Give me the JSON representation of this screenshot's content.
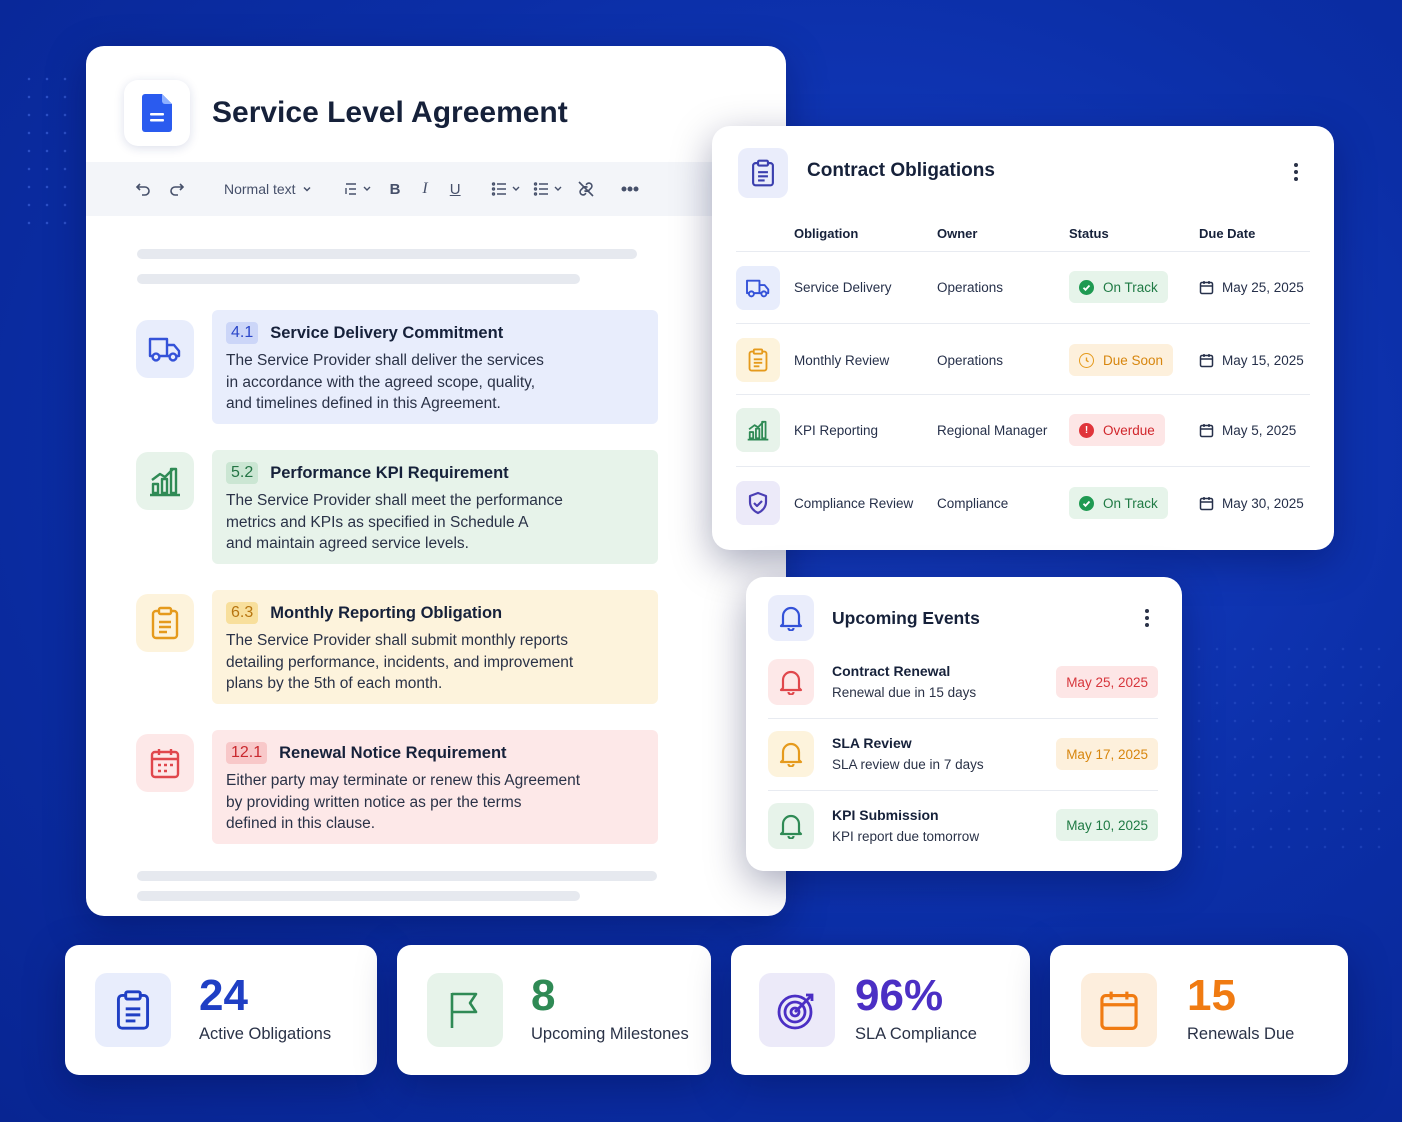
{
  "document": {
    "title": "Service Level Agreement",
    "toolbar": {
      "style_select": "Normal text"
    },
    "clauses": [
      {
        "number": "4.1",
        "title": "Service Delivery Commitment",
        "icon": "truck-icon",
        "lines": [
          "The Service Provider shall deliver the services",
          "in accordance with the agreed scope, quality,",
          "and timelines defined in this Agreement."
        ],
        "accent": "#3452d8",
        "bg": "#e8edfc"
      },
      {
        "number": "5.2",
        "title": "Performance KPI Requirement",
        "icon": "chart-icon",
        "lines": [
          "The Service Provider shall meet the performance",
          "metrics and KPIs as specified in Schedule A",
          "and maintain agreed service levels."
        ],
        "accent": "#2f8a55",
        "bg": "#e7f3ea"
      },
      {
        "number": "6.3",
        "title": "Monthly Reporting Obligation",
        "icon": "clipboard-icon",
        "lines": [
          "The Service Provider shall submit monthly reports",
          "detailing performance, incidents, and improvement",
          "plans by the 5th of each month."
        ],
        "accent": "#e59a1c",
        "bg": "#fdf3dc"
      },
      {
        "number": "12.1",
        "title": "Renewal Notice Requirement",
        "icon": "calendar-icon",
        "lines": [
          "Either party may terminate or renew this Agreement",
          "by providing written notice as per the terms",
          "defined in this clause."
        ],
        "accent": "#e0474c",
        "bg": "#fde8e8"
      }
    ]
  },
  "obligations": {
    "title": "Contract Obligations",
    "columns": [
      "Obligation",
      "Owner",
      "Status",
      "Due Date"
    ],
    "rows": [
      {
        "obligation": "Service Delivery",
        "owner": "Operations",
        "status": "On Track",
        "due": "May 25, 2025",
        "icon": "truck-icon"
      },
      {
        "obligation": "Monthly Review",
        "owner": "Operations",
        "status": "Due Soon",
        "due": "May 15, 2025",
        "icon": "clipboard-icon"
      },
      {
        "obligation": "KPI Reporting",
        "owner": "Regional Manager",
        "status": "Overdue",
        "due": "May 5, 2025",
        "icon": "chart-icon"
      },
      {
        "obligation": "Compliance Review",
        "owner": "Compliance",
        "status": "On Track",
        "due": "May 30, 2025",
        "icon": "shield-icon"
      }
    ]
  },
  "events": {
    "title": "Upcoming Events",
    "items": [
      {
        "title": "Contract Renewal",
        "subtitle": "Renewal due in 15 days",
        "date": "May 25, 2025",
        "icon": "bell-icon"
      },
      {
        "title": "SLA Review",
        "subtitle": "SLA review due in 7 days",
        "date": "May 17, 2025",
        "icon": "bell-icon"
      },
      {
        "title": "KPI Submission",
        "subtitle": "KPI report due tomorrow",
        "date": "May 10, 2025",
        "icon": "bell-icon"
      }
    ]
  },
  "stats": [
    {
      "value": "24",
      "label": "Active Obligations",
      "icon": "clipboard-icon",
      "color": "#1f3fc4"
    },
    {
      "value": "8",
      "label": "Upcoming Milestones",
      "icon": "flag-icon",
      "color": "#2f8a55"
    },
    {
      "value": "96%",
      "label": "SLA Compliance",
      "icon": "target-icon",
      "color": "#4b2fc4"
    },
    {
      "value": "15",
      "label": "Renewals Due",
      "icon": "calendar-icon",
      "color": "#f07b12"
    }
  ]
}
